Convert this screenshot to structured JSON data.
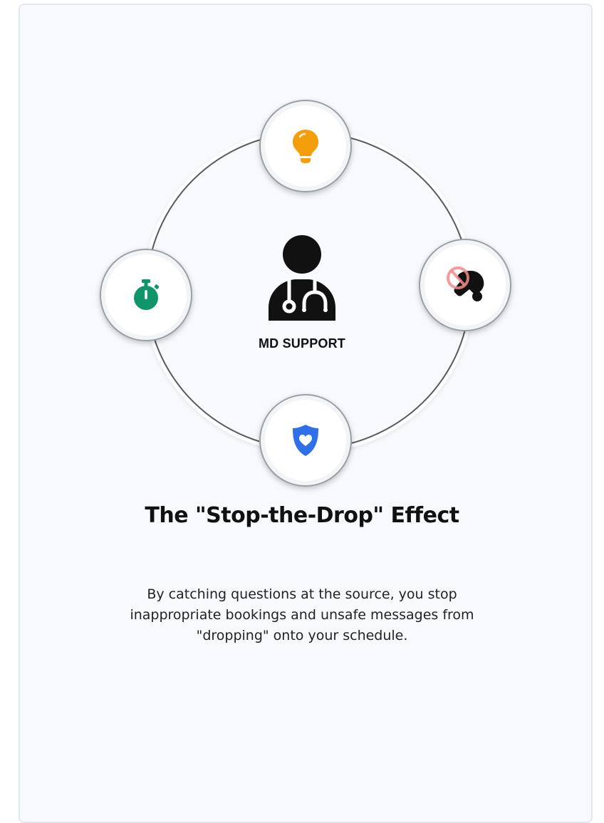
{
  "center": {
    "label": "MD SUPPORT",
    "icon": "doctor-icon"
  },
  "nodes": {
    "top": {
      "icon": "lightbulb-icon",
      "color": "#f59e0b"
    },
    "right": {
      "icon": "ping-pong-prohibited-icon",
      "color": "#111111",
      "accent": "#f28b8b"
    },
    "bottom": {
      "icon": "shield-heart-icon",
      "color": "#2f6fe8"
    },
    "left": {
      "icon": "stopwatch-icon",
      "color": "#10956b"
    }
  },
  "title": "The \"Stop-the-Drop\" Effect",
  "description": "By catching questions at the source, you stop inappropriate bookings and unsafe messages from \"dropping\" onto your schedule."
}
